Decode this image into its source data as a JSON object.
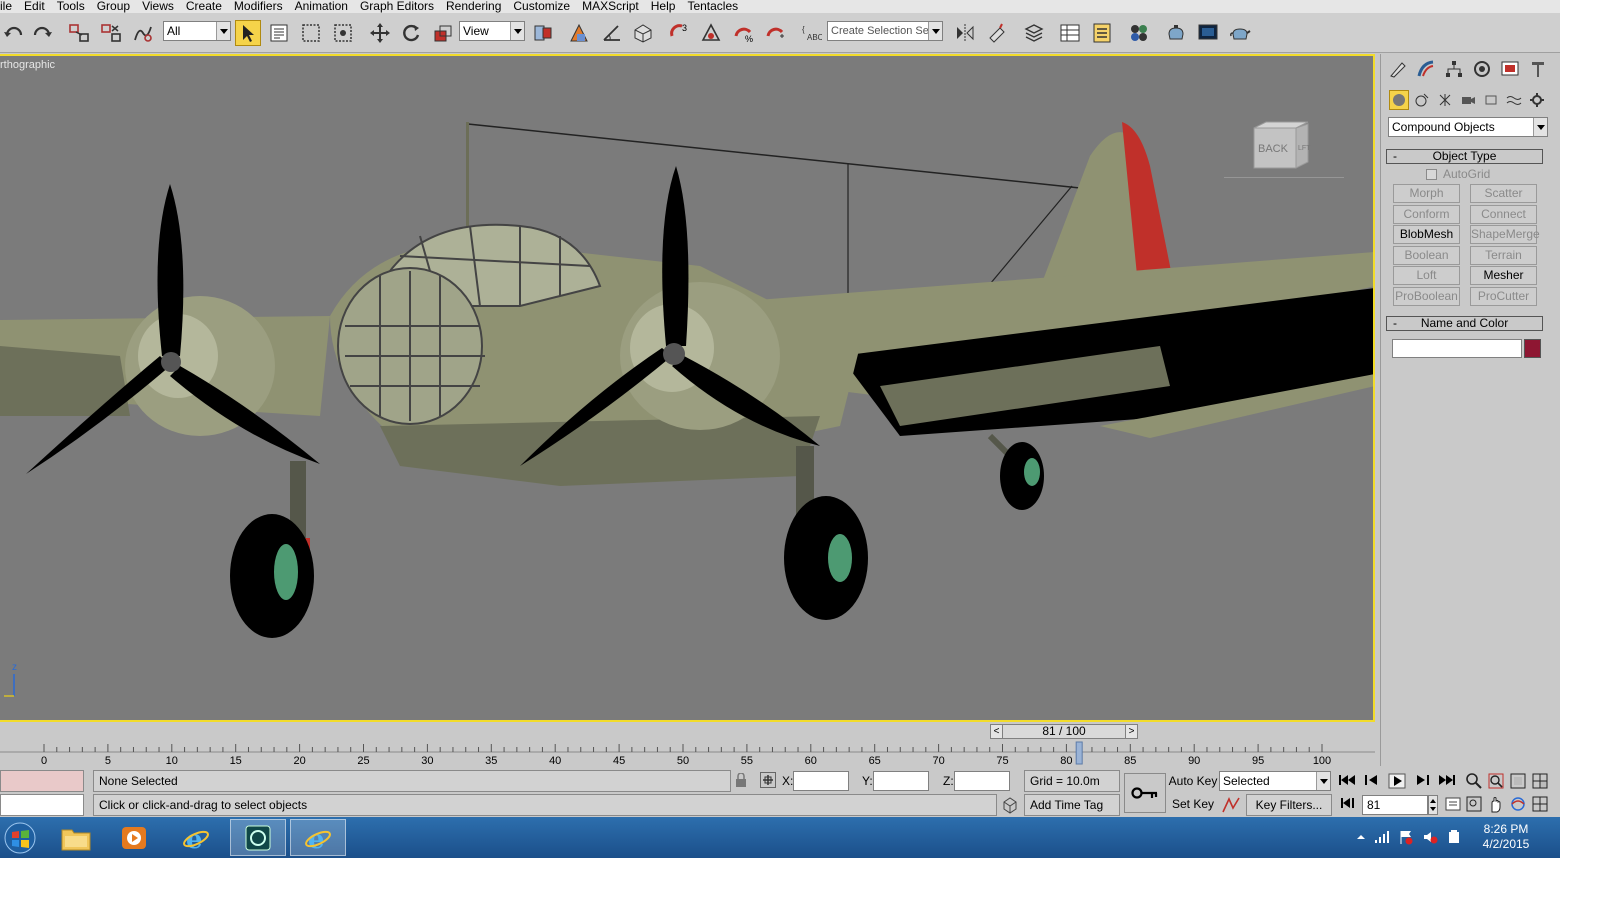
{
  "menu": [
    "ile",
    "Edit",
    "Tools",
    "Group",
    "Views",
    "Create",
    "Modifiers",
    "Animation",
    "Graph Editors",
    "Rendering",
    "Customize",
    "MAXScript",
    "Help",
    "Tentacles"
  ],
  "toolbar": {
    "filter_value": "All",
    "refcoord_value": "View",
    "selection_set_placeholder": "Create Selection Set",
    "snap_label": "3",
    "icons": [
      "undo-icon",
      "redo-icon",
      "select-link-icon",
      "unlink-icon",
      "bind-spacewarp-icon",
      "select-object-icon",
      "select-by-name-icon",
      "rect-region-icon",
      "window-crossing-icon",
      "move-icon",
      "rotate-icon",
      "scale-icon",
      "mirror-icon",
      "align-icon",
      "layer-manager-icon",
      "curve-editor-icon",
      "schematic-view-icon",
      "material-editor-icon",
      "render-setup-icon",
      "rendered-frame-icon",
      "render-teapot-icon"
    ]
  },
  "viewport": {
    "label": "rthographic",
    "viewcube_face": "BACK",
    "viewcube_side": "LFT",
    "axis_label": "z"
  },
  "command_panel": {
    "dropdown_value": "Compound Objects",
    "object_type_title": "Object Type",
    "autogrid_label": "AutoGrid",
    "buttons": [
      {
        "label": "Morph",
        "enabled": false
      },
      {
        "label": "Scatter",
        "enabled": false
      },
      {
        "label": "Conform",
        "enabled": false
      },
      {
        "label": "Connect",
        "enabled": false
      },
      {
        "label": "BlobMesh",
        "enabled": true
      },
      {
        "label": "ShapeMerge",
        "enabled": false
      },
      {
        "label": "Boolean",
        "enabled": false
      },
      {
        "label": "Terrain",
        "enabled": false
      },
      {
        "label": "Loft",
        "enabled": false
      },
      {
        "label": "Mesher",
        "enabled": true
      },
      {
        "label": "ProBoolean",
        "enabled": false
      },
      {
        "label": "ProCutter",
        "enabled": false
      }
    ],
    "name_color_title": "Name and Color",
    "name_value": "",
    "swatch_color": "#8e1632"
  },
  "time_slider": {
    "value": "81 / 100",
    "prev": "<",
    "next": ">"
  },
  "trackbar": {
    "ticks": [
      "0",
      "5",
      "10",
      "15",
      "20",
      "25",
      "30",
      "35",
      "40",
      "45",
      "50",
      "55",
      "60",
      "65",
      "70",
      "75",
      "80",
      "85",
      "90",
      "95",
      "100"
    ],
    "current_frame": 81
  },
  "status": {
    "selection_text": "None Selected",
    "prompt_text": "Click or click-and-drag to select objects",
    "x_label": "X:",
    "y_label": "Y:",
    "z_label": "Z:",
    "x_value": "",
    "y_value": "",
    "z_value": "",
    "grid_text": "Grid = 10.0m",
    "add_time_tag": "Add Time Tag",
    "auto_key": "Auto Key",
    "set_key": "Set Key",
    "key_mode_value": "Selected",
    "key_filters": "Key Filters...",
    "frame_value": "81"
  },
  "taskbar": {
    "time": "8:26 PM",
    "date": "4/2/2015"
  },
  "colors": {
    "viewport_bg": "#7b7b7b",
    "viewport_border": "#f2dc2a",
    "fuselage": "#8f9272",
    "rudder": "#c0302a"
  }
}
